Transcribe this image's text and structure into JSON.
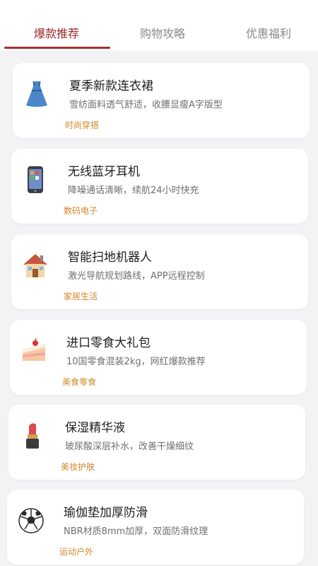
{
  "tabs": [
    {
      "label": "爆款推荐",
      "active": true
    },
    {
      "label": "购物攻略",
      "active": false
    },
    {
      "label": "优惠福利",
      "active": false
    }
  ],
  "accent_color": "#a5302f",
  "tag_color": "#d0872a",
  "items": [
    {
      "title": "夏季新款连衣裙",
      "desc": "雪纺面料透气舒适，收腰显瘦A字版型",
      "tag": "时尚穿搭",
      "icon": "dress-icon"
    },
    {
      "title": "无线蓝牙耳机",
      "desc": "降噪通话清晰，续航24小时快充",
      "tag": "数码电子",
      "icon": "phone-icon"
    },
    {
      "title": "智能扫地机器人",
      "desc": "激光导航规划路线，APP远程控制",
      "tag": "家居生活",
      "icon": "house-icon"
    },
    {
      "title": "进口零食大礼包",
      "desc": "10国零食混装2kg，网红爆款推荐",
      "tag": "美食零食",
      "icon": "cake-icon"
    },
    {
      "title": "保湿精华液",
      "desc": "玻尿酸深层补水，改善干燥细纹",
      "tag": "美妆护肤",
      "icon": "lipstick-icon"
    },
    {
      "title": "瑜伽垫加厚防滑",
      "desc": "NBR材质8mm加厚，双面防滑纹理",
      "tag": "运动户外",
      "icon": "soccer-ball-icon"
    }
  ]
}
